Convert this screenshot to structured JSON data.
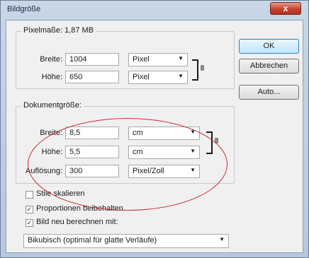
{
  "window": {
    "title": "Bildgröße",
    "close_label": "x"
  },
  "pixel_group": {
    "legend_label": "Pixelmaße:",
    "legend_value": "1,87 MB",
    "width_label": "Breite:",
    "width_value": "1004",
    "width_unit": "Pixel",
    "height_label": "Höhe:",
    "height_value": "650",
    "height_unit": "Pixel"
  },
  "document_group": {
    "legend": "Dokumentgröße:",
    "width_label": "Breite:",
    "width_value": "8,5",
    "width_unit": "cm",
    "height_label": "Höhe:",
    "height_value": "5,5",
    "height_unit": "cm",
    "resolution_label": "Auflösung:",
    "resolution_value": "300",
    "resolution_unit": "Pixel/Zoll"
  },
  "buttons": {
    "ok": "OK",
    "cancel": "Abbrechen",
    "auto": "Auto..."
  },
  "options": {
    "scale_styles": {
      "label": "Stile skalieren",
      "checked": false
    },
    "constrain": {
      "label": "Proportionen beibehalten",
      "checked": true
    },
    "resample": {
      "label": "Bild neu berechnen mit:",
      "checked": true
    }
  },
  "resample_method": {
    "value": "Bikubisch (optimal für glatte Verläufe)"
  },
  "annotation": {
    "color": "#c8283a"
  },
  "icons": {
    "chain": "chain-link-icon",
    "dropdown": "dropdown-arrow-icon",
    "check": "checkmark-icon"
  }
}
